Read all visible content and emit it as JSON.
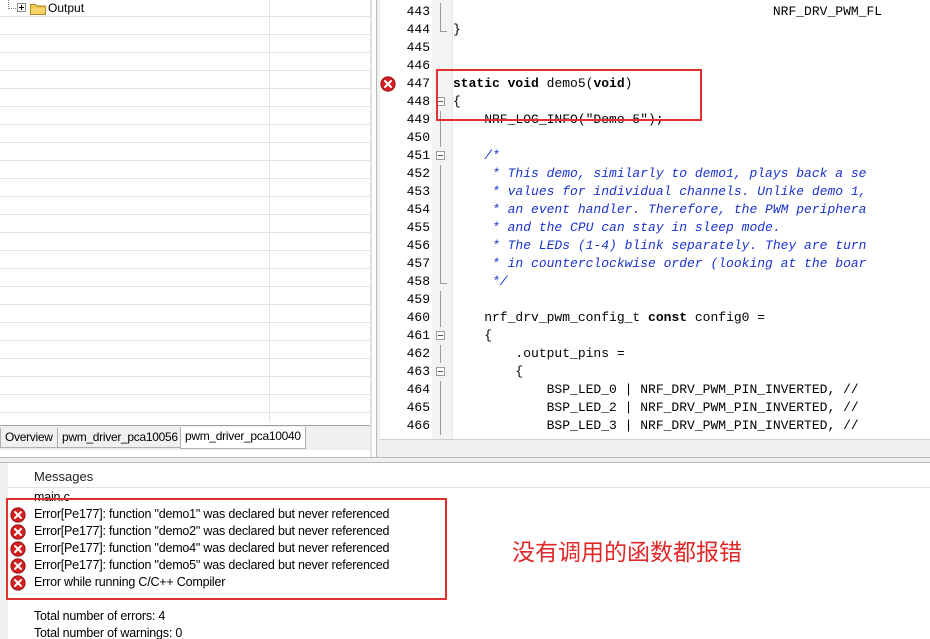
{
  "workspace": {
    "tree": {
      "folder_label": "Output"
    },
    "tabs": [
      {
        "label": "Overview"
      },
      {
        "label": "pwm_driver_pca10056"
      },
      {
        "label": "pwm_driver_pca10040"
      }
    ]
  },
  "editor": {
    "lines": [
      {
        "num": "443",
        "text": "                                         NRF_DRV_PWM_FL"
      },
      {
        "num": "444",
        "text": "}"
      },
      {
        "num": "445",
        "text": ""
      },
      {
        "num": "446",
        "text": ""
      },
      {
        "num": "447",
        "text": "static void demo5(void)"
      },
      {
        "num": "448",
        "text": "{"
      },
      {
        "num": "449",
        "text": "    NRF_LOG_INFO(\"Demo 5\");"
      },
      {
        "num": "450",
        "text": ""
      },
      {
        "num": "451",
        "text": "    /*"
      },
      {
        "num": "452",
        "text": "     * This demo, similarly to demo1, plays back a se"
      },
      {
        "num": "453",
        "text": "     * values for individual channels. Unlike demo 1,"
      },
      {
        "num": "454",
        "text": "     * an event handler. Therefore, the PWM periphera"
      },
      {
        "num": "455",
        "text": "     * and the CPU can stay in sleep mode."
      },
      {
        "num": "456",
        "text": "     * The LEDs (1-4) blink separately. They are turn"
      },
      {
        "num": "457",
        "text": "     * in counterclockwise order (looking at the boar"
      },
      {
        "num": "458",
        "text": "     */"
      },
      {
        "num": "459",
        "text": ""
      },
      {
        "num": "460",
        "text": "    nrf_drv_pwm_config_t const config0 ="
      },
      {
        "num": "461",
        "text": "    {"
      },
      {
        "num": "462",
        "text": "        .output_pins ="
      },
      {
        "num": "463",
        "text": "        {"
      },
      {
        "num": "464",
        "text": "            BSP_LED_0 | NRF_DRV_PWM_PIN_INVERTED, //"
      },
      {
        "num": "465",
        "text": "            BSP_LED_2 | NRF_DRV_PWM_PIN_INVERTED, //"
      },
      {
        "num": "466",
        "text": "            BSP_LED_3 | NRF_DRV_PWM_PIN_INVERTED, //"
      }
    ]
  },
  "messages": {
    "header": "Messages",
    "file": "main.c",
    "errors": [
      "Error[Pe177]: function \"demo1\" was declared but never referenced",
      "Error[Pe177]: function \"demo2\" was declared but never referenced",
      "Error[Pe177]: function \"demo4\" was declared but never referenced",
      "Error[Pe177]: function \"demo5\" was declared but never referenced",
      "Error while running C/C++ Compiler"
    ],
    "summary": [
      "Total number of errors: 4",
      "Total number of warnings: 0"
    ]
  },
  "annotation": "没有调用的函数都报错",
  "colors": {
    "highlight_box": "#e03030",
    "comment": "#1a33cc",
    "error_icon": "#d42020",
    "annotation": "#e02828"
  },
  "icons": {
    "folder": "folder-icon",
    "error": "error-icon",
    "expand": "expand-plus-icon",
    "collapse": "collapse-minus-icon"
  }
}
